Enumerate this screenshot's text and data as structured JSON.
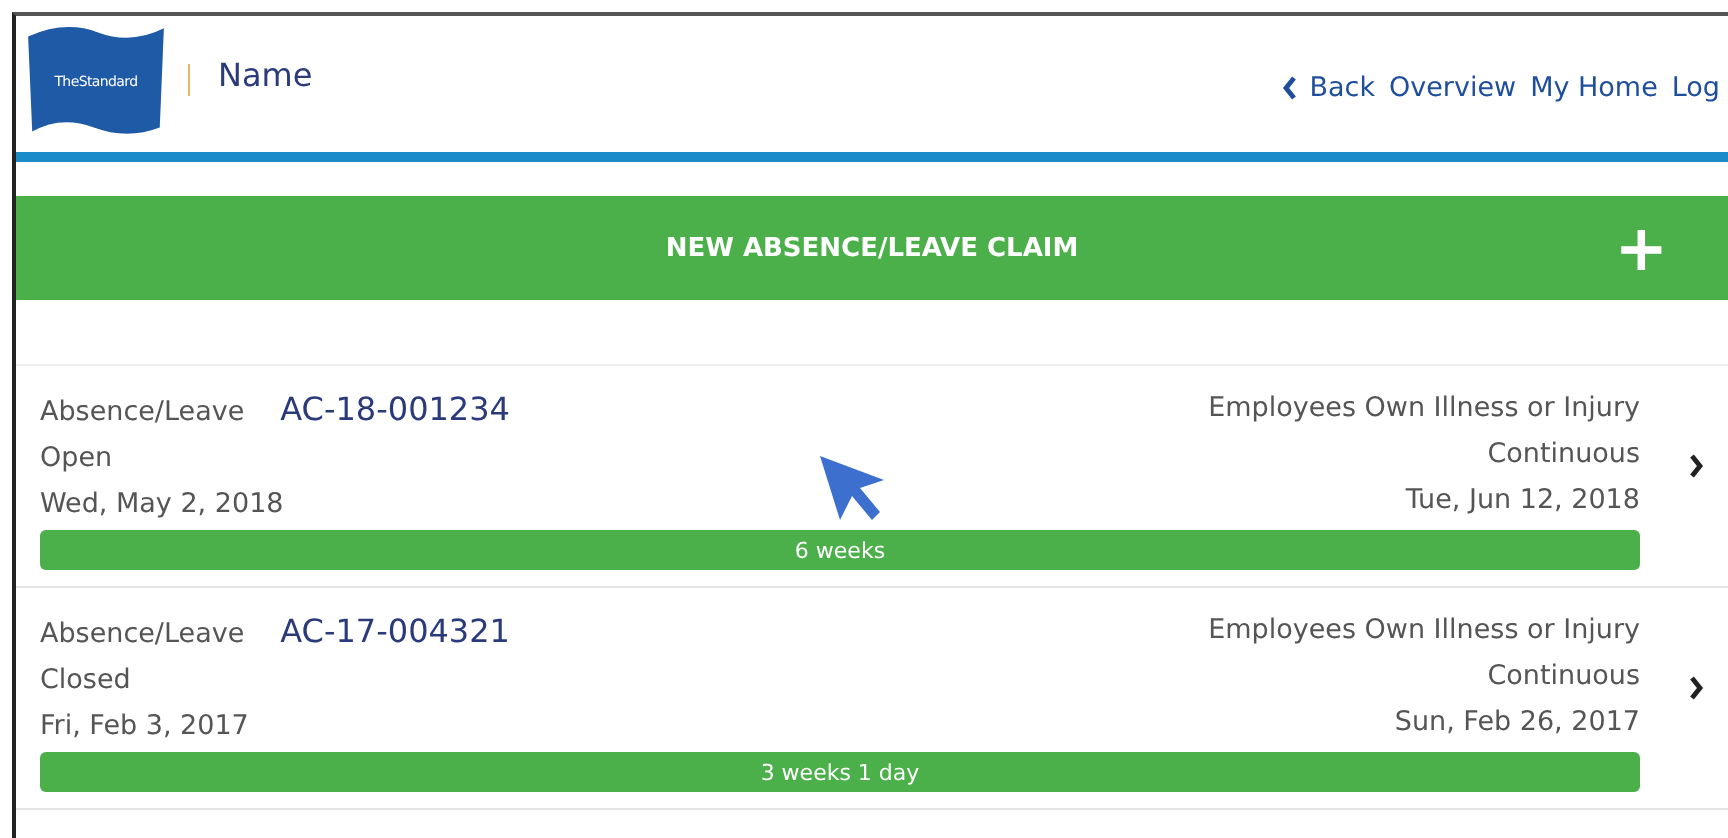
{
  "header": {
    "logo": "TheStandard",
    "title": "Name",
    "nav": [
      {
        "label": "Back",
        "kind": "back"
      },
      {
        "label": "Overview",
        "kind": "link"
      },
      {
        "label": "My Home",
        "kind": "link"
      },
      {
        "label": "Log",
        "kind": "link"
      }
    ]
  },
  "new_claim": {
    "label": "NEW ABSENCE/LEAVE CLAIM",
    "icon": "+"
  },
  "claims": [
    {
      "type": "Absence/Leave",
      "number": "AC-18-001234",
      "status": "Open",
      "start": "Wed, May 2, 2018",
      "reason": "Employees Own Illness or Injury",
      "frequency": "Continuous",
      "end": "Tue, Jun 12, 2018",
      "duration": "6 weeks",
      "level": 1
    },
    {
      "type": "Absence/Leave",
      "number": "AC-17-004321",
      "status": "Closed",
      "start": "Fri, Feb 3, 2017",
      "reason": "Employees Own Illness or Injury",
      "frequency": "Continuous",
      "end": "Sun, Feb 26, 2017",
      "duration": "3 weeks 1 day",
      "level": 1
    }
  ]
}
